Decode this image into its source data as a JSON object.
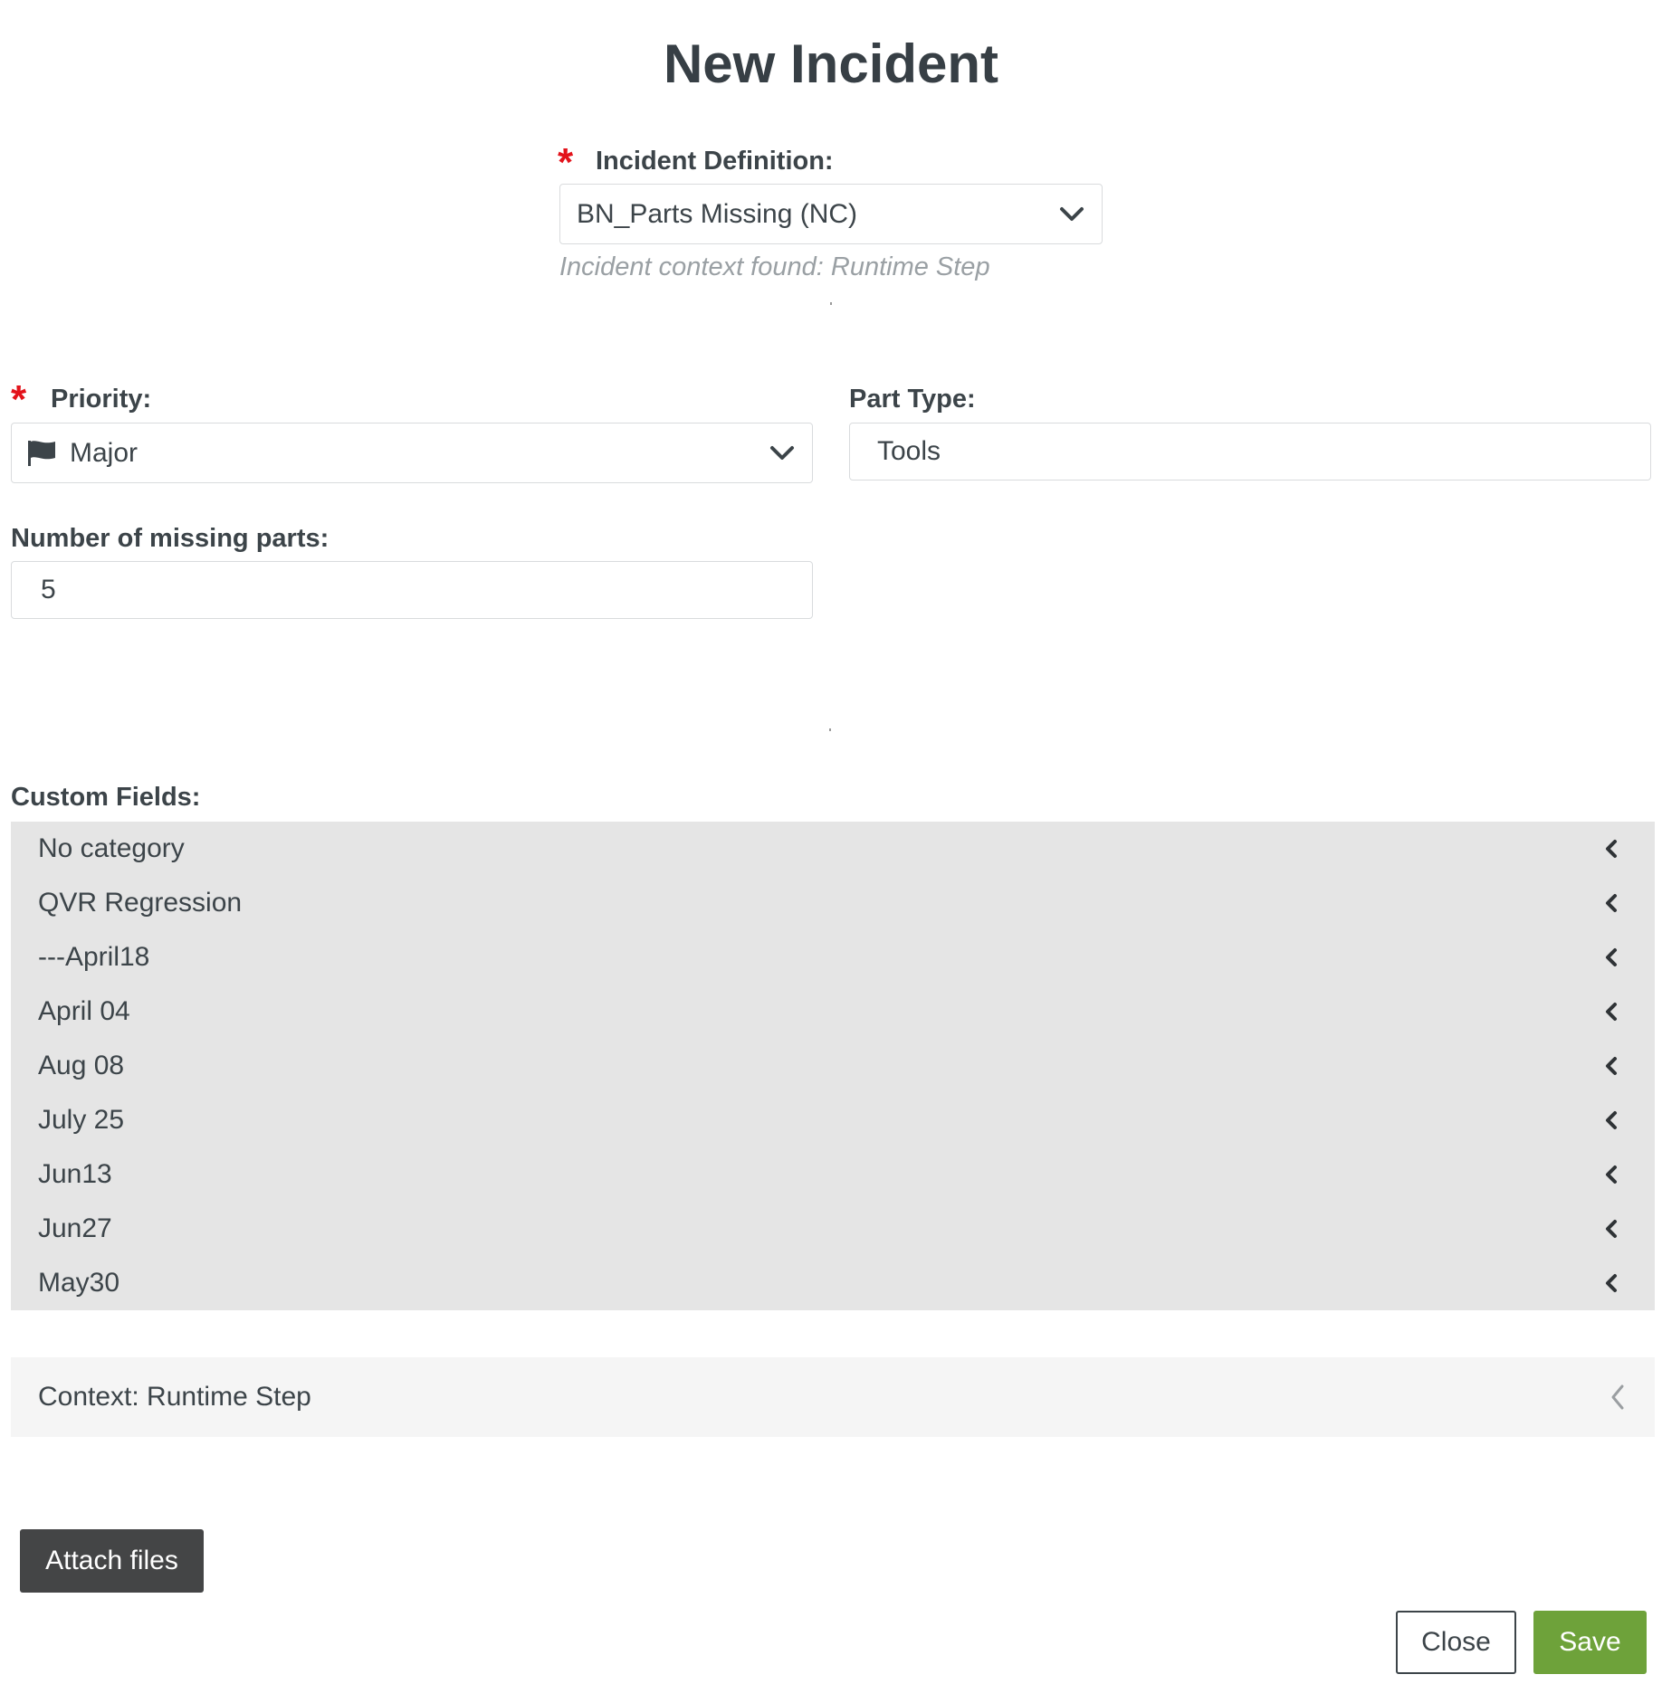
{
  "dialog": {
    "title": "New Incident"
  },
  "incident_definition": {
    "required_mark": "*",
    "label": "Incident Definition:",
    "value": "BN_Parts Missing (NC)",
    "hint": "Incident context found: Runtime Step"
  },
  "priority": {
    "required_mark": "*",
    "label": "Priority:",
    "value": "Major",
    "icon": "flag-icon"
  },
  "part_type": {
    "label": "Part Type:",
    "value": "Tools"
  },
  "missing_parts": {
    "label": "Number of missing parts:",
    "value": "5"
  },
  "custom_fields": {
    "label": "Custom Fields:",
    "categories": [
      {
        "label": "No category"
      },
      {
        "label": "QVR Regression"
      },
      {
        "label": "---April18"
      },
      {
        "label": "April 04"
      },
      {
        "label": "Aug 08"
      },
      {
        "label": "July 25"
      },
      {
        "label": "Jun13"
      },
      {
        "label": "Jun27"
      },
      {
        "label": "May30"
      }
    ]
  },
  "context": {
    "label": "Context: Runtime Step"
  },
  "buttons": {
    "attach": "Attach files",
    "close": "Close",
    "save": "Save"
  },
  "colors": {
    "required": "#e3131b",
    "save": "#6ea23a",
    "attach": "#444546",
    "panel": "#e5e5e5"
  }
}
